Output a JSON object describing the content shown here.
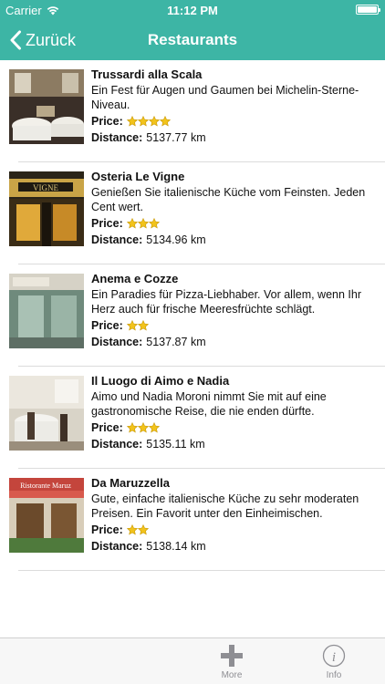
{
  "status_bar": {
    "carrier": "Carrier",
    "time": "11:12 PM"
  },
  "nav": {
    "back_label": "Zurück",
    "title": "Restaurants"
  },
  "labels": {
    "price": "Price:",
    "distance": "Distance:"
  },
  "star_color": "#f2c31b",
  "restaurants": [
    {
      "name": "Trussardi alla Scala",
      "description": "Ein Fest für Augen und Gaumen bei Michelin-Sterne-Niveau.",
      "price_stars": 4,
      "distance": "5137.77 km"
    },
    {
      "name": "Osteria Le Vigne",
      "description": "Genießen Sie italienische Küche vom Feinsten. Jeden Cent wert.",
      "price_stars": 3,
      "distance": "5134.96 km"
    },
    {
      "name": "Anema e Cozze",
      "description": "Ein Paradies für Pizza-Liebhaber. Vor allem, wenn Ihr Herz auch für frische Meeresfrüchte schlägt.",
      "price_stars": 2,
      "distance": "5137.87 km"
    },
    {
      "name": "Il Luogo di Aimo e Nadia",
      "description": "Aimo und Nadia Moroni nimmt Sie mit auf eine gastronomische Reise, die nie enden dürfte.",
      "price_stars": 3,
      "distance": "5135.11 km"
    },
    {
      "name": "Da Maruzzella",
      "description": "Gute, einfache italienische Küche zu sehr moderaten Preisen. Ein Favorit unter den Einheimischen.",
      "price_stars": 2,
      "distance": "5138.14 km"
    }
  ],
  "tabs": [
    {
      "label": "More",
      "icon": "plus-icon"
    },
    {
      "label": "Info",
      "icon": "info-icon"
    }
  ]
}
